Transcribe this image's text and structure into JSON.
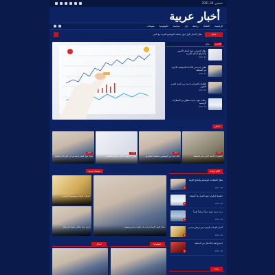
{
  "topbar": {
    "date": "خميس, 29 2021"
  },
  "site": {
    "logo": "أخبار عربية"
  },
  "nav": {
    "items": [
      "الرئيسية",
      "اقتصاد",
      "رياضة",
      "فن",
      "سياسة",
      "تكنولوجيا",
      "منوعات"
    ]
  },
  "ticker": {
    "label": "عاجل",
    "text": "مقال الاختبار الأول حول مختلف المواضيع العربية مع النص"
  },
  "side": {
    "tab_active": "الأحدث",
    "tab_other": "شائع",
    "items": [
      {
        "title": "مقال اقتصادي حول أسعار الأسهم والأسواق المالية العربية",
        "date": "2021 ,29"
      },
      {
        "title": "تطور جديد في الأحداث السياسية الأخيرة في المنطقة",
        "date": "2021 ,29"
      },
      {
        "title": "اتفاقيات اقتصادية جديدة بين الدول لتعزيز التعاون",
        "date": "2021 ,29"
      },
      {
        "title": "رحلات جوية جديدة تنطلق من المطارات الرئيسية",
        "date": "2021 ,29"
      }
    ]
  },
  "section1": {
    "label": "أعمال"
  },
  "cards4": [
    {
      "cap": "مقال حول العمل الجماعي في الشركات الناشئة",
      "badge": "أعمال"
    },
    {
      "cap": "تحليل الأسواق المالية والنمو الاقتصادي",
      "badge": "اقتصاد"
    },
    {
      "cap": "لقاء عمل بين الموظفين لمناقشة المشاريع",
      "badge": "أعمال"
    },
    {
      "cap": "التطورات الأمنية الأخيرة في المنطقة",
      "badge": "سياسة"
    }
  ],
  "section2": {
    "label": "منوعات عربية"
  },
  "grid2": {
    "big_cap": "مقال العمل الجماعي في بيئة مكتبية حديثة ومتطورة",
    "sm1_cap": "العملات الرقمية ومستقبل الاستثمار",
    "sm2_cap": "فريق عمل يناقش خطط المستقبل"
  },
  "rlist": {
    "label": "الأكثر قراءة",
    "items": [
      {
        "num": "1",
        "title": "مقال الانتخابات البرلمانية والنتائج الأولية",
        "date": "2021 ,29"
      },
      {
        "num": "2",
        "title": "خطوط الطيران تعود للعمل بعد التوقف",
        "date": "2021 ,29"
      },
      {
        "num": "3",
        "title": "مدن عربية تشهد نمواً عمرانياً كبيراً",
        "date": "2021 ,29"
      },
      {
        "num": "4",
        "title": "أسعار العملات الرقمية في ارتفاع مستمر",
        "date": "2021 ,29"
      },
      {
        "num": "5",
        "title": "اجتماع لقادة الأعمال في المنطقة",
        "date": "2021 ,29"
      }
    ]
  },
  "bottom": {
    "left_label": "أعمال",
    "right_label": "تكنولوجيا"
  },
  "rbot": {
    "label": "رياضة"
  },
  "colors": {
    "accent": "#c8151b",
    "bg": "#0a1a4a",
    "panel": "#0d2260"
  }
}
